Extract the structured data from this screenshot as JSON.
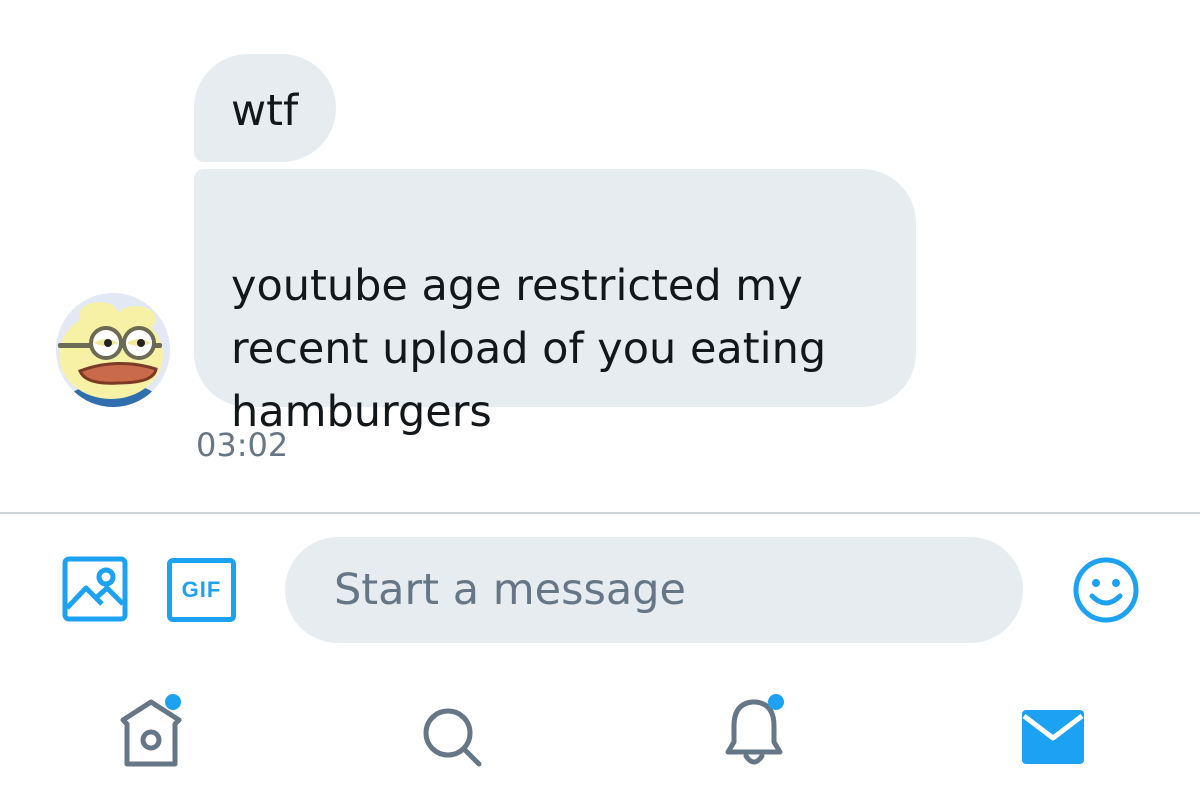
{
  "messages": [
    {
      "text": "wtf"
    },
    {
      "text": "youtube age restricted my\nrecent upload of you eating\nhamburgers"
    }
  ],
  "timestamp": "03:02",
  "composer": {
    "gif_label": "GIF",
    "placeholder": "Start a message"
  },
  "tabs": [
    {
      "icon": "home-icon",
      "has_notification_dot": true
    },
    {
      "icon": "search-icon",
      "has_notification_dot": false
    },
    {
      "icon": "notifications-bell-icon",
      "has_notification_dot": true
    },
    {
      "icon": "messages-envelope-icon",
      "active": true
    }
  ],
  "colors": {
    "accent": "#1da1f2",
    "bubble_bg": "#e6ecf0",
    "muted_text": "#657786",
    "inactive_icon": "#657786"
  }
}
